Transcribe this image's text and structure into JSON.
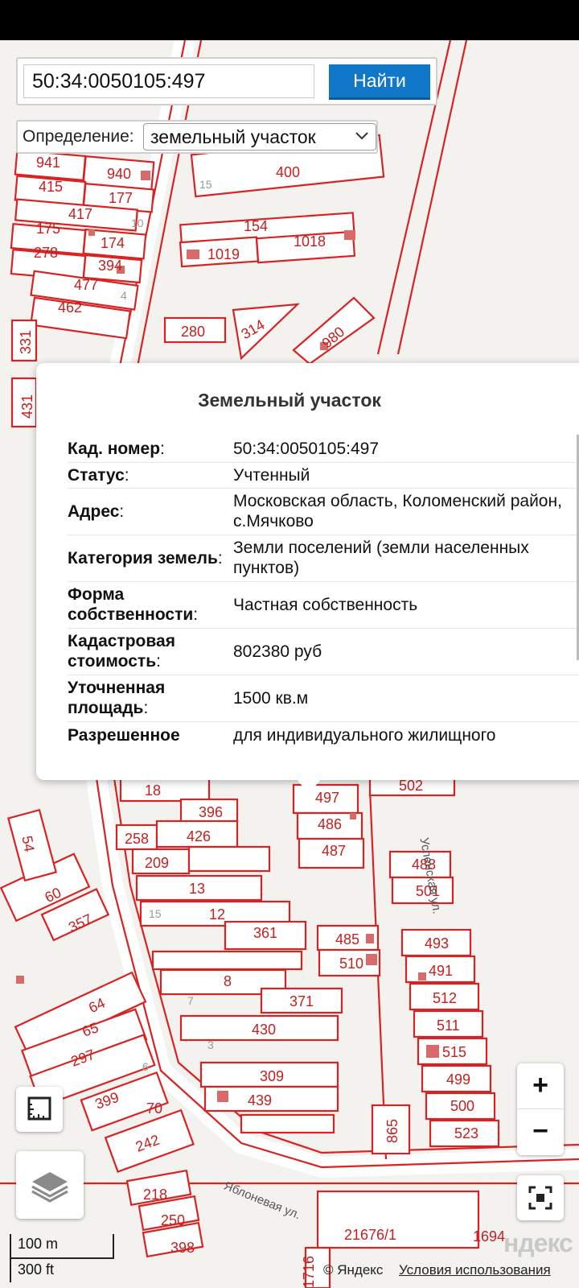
{
  "search": {
    "value": "50:34:0050105:497",
    "button_label": "Найти"
  },
  "definition": {
    "label": "Определение:",
    "selected": "земельный участок"
  },
  "popup": {
    "title": "Земельный участок",
    "rows": [
      {
        "key": "Кад. номер",
        "value": "50:34:0050105:497"
      },
      {
        "key": "Статус",
        "value": "Учтенный"
      },
      {
        "key": "Адрес",
        "value": "Московская область, Коломенский район, с.Мячково"
      },
      {
        "key": "Категория земель",
        "value": "Земли поселений (земли населенных пунктов)"
      },
      {
        "key": "Форма собственности",
        "value": "Частная собственность"
      },
      {
        "key": "Кадастровая стоимость",
        "value": "802380 руб"
      },
      {
        "key": "Уточненная площадь",
        "value": "1500 кв.м"
      },
      {
        "key": "Разрешенное",
        "value": "для индивидуального жилищного"
      }
    ],
    "colon": ":"
  },
  "map": {
    "parcels_top": [
      "941",
      "940",
      "415",
      "177",
      "417",
      "175",
      "174",
      "278",
      "394",
      "477",
      "462",
      "331",
      "431",
      "400",
      "154",
      "1019",
      "1018",
      "280",
      "314",
      "980"
    ],
    "parcels_bottom": [
      "18",
      "396",
      "258",
      "426",
      "209",
      "13",
      "60",
      "357",
      "12",
      "361",
      "485",
      "510",
      "8",
      "371",
      "64",
      "65",
      "430",
      "297",
      "309",
      "439",
      "399",
      "70",
      "242",
      "218",
      "250",
      "398",
      "21676/1",
      "1694",
      "1716",
      "497",
      "486",
      "487",
      "502",
      "488",
      "501",
      "493",
      "491",
      "512",
      "511",
      "515",
      "499",
      "500",
      "523",
      "865",
      "54"
    ],
    "house_numbers": [
      "15",
      "10",
      "4",
      "15",
      "7",
      "3",
      "6"
    ],
    "street_names": [
      "Успенская ул.",
      "Яблоневая ул."
    ]
  },
  "controls": {
    "zoom_in": "+",
    "zoom_out": "−"
  },
  "scale": {
    "meters": "100 m",
    "feet": "300 ft"
  },
  "footer": {
    "copyright": "© Яндекс",
    "terms": "Условия использования",
    "logo": "ндекс"
  }
}
